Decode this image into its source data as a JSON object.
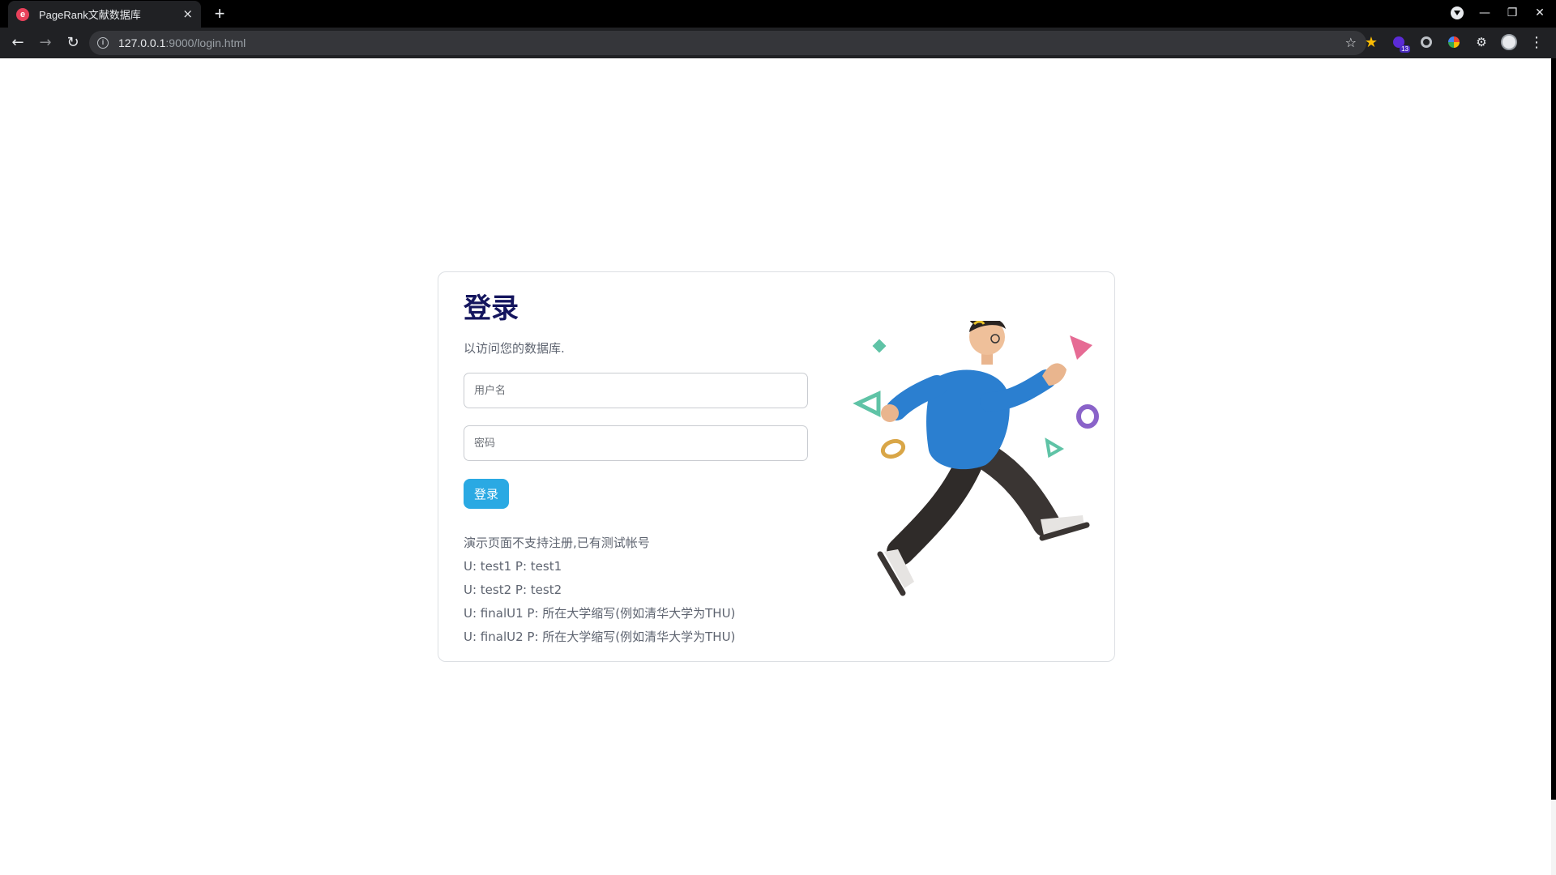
{
  "browser": {
    "tab_title": "PageRank文献数据库",
    "tab_favicon_letter": "e",
    "tab_close": "×",
    "new_tab": "+",
    "url_host": "127.0.0.1",
    "url_path": ":9000/login.html",
    "extension_badge": "13",
    "accent_color": "#202124"
  },
  "login": {
    "title": "登录",
    "subtitle": "以访问您的数据库.",
    "username_placeholder": "用户名",
    "password_placeholder": "密码",
    "submit_label": "登录",
    "button_color": "#2aa9e3",
    "title_color": "#14155e"
  },
  "notes": [
    "演示页面不支持注册,已有测试帐号",
    "U: test1 P: test1",
    "U: test2 P: test2",
    "U: finalU1 P: 所在大学缩写(例如清华大学为THU)",
    "U: finalU2 P: 所在大学缩写(例如清华大学为THU)"
  ]
}
